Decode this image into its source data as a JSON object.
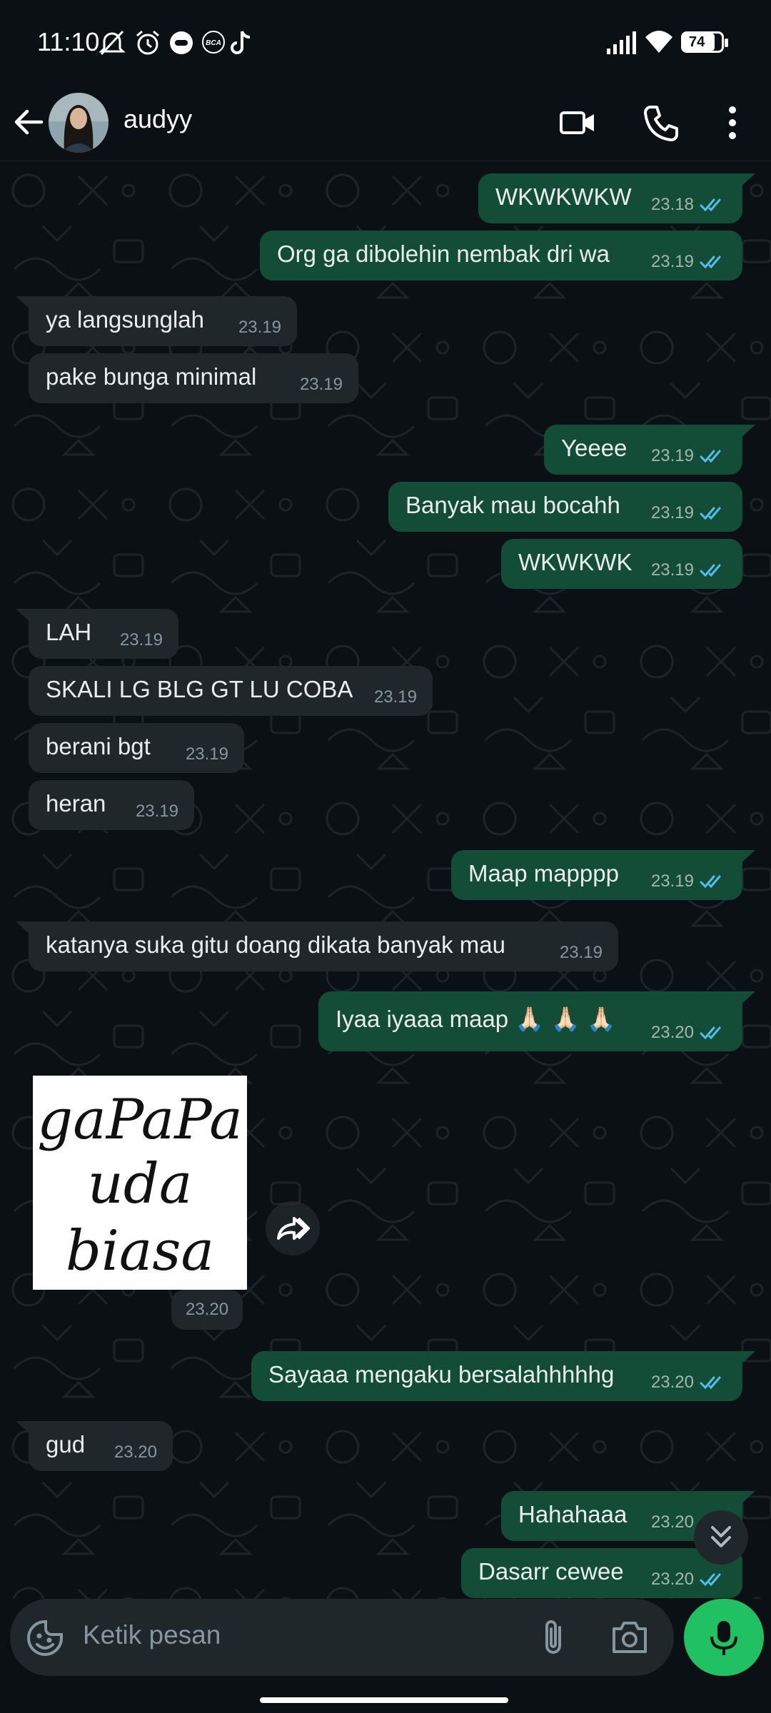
{
  "status_bar": {
    "time": "11:10",
    "battery": "74",
    "left_icons": [
      "mute-icon",
      "alarm-icon",
      "media-icon",
      "bca-icon",
      "tiktok-icon"
    ],
    "right_icons": [
      "signal-icon",
      "wifi-icon",
      "battery-icon"
    ]
  },
  "header": {
    "contact_name": "audyy",
    "icons": [
      "back-arrow-icon",
      "avatar",
      "video-call-icon",
      "voice-call-icon",
      "more-options-icon"
    ]
  },
  "messages": [
    {
      "dir": "out",
      "text": "WKWKWKW",
      "time": "23.18",
      "read": true
    },
    {
      "dir": "out",
      "text": "Org ga dibolehin nembak dri wa",
      "time": "23.19",
      "read": true
    },
    {
      "dir": "in",
      "text": "ya langsunglah",
      "time": "23.19"
    },
    {
      "dir": "in",
      "text": "pake bunga minimal",
      "time": "23.19"
    },
    {
      "dir": "out",
      "text": "Yeeee",
      "time": "23.19",
      "read": true
    },
    {
      "dir": "out",
      "text": "Banyak mau bocahh",
      "time": "23.19",
      "read": true
    },
    {
      "dir": "out",
      "text": "WKWKWK",
      "time": "23.19",
      "read": true
    },
    {
      "dir": "in",
      "text": "LAH",
      "time": "23.19"
    },
    {
      "dir": "in",
      "text": "SKALI LG BLG GT LU COBA",
      "time": "23.19"
    },
    {
      "dir": "in",
      "text": "berani bgt",
      "time": "23.19"
    },
    {
      "dir": "in",
      "text": "heran",
      "time": "23.19"
    },
    {
      "dir": "out",
      "text": "Maap mapppp",
      "time": "23.19",
      "read": true
    },
    {
      "dir": "in",
      "text": "katanya suka gitu doang dikata banyak mau",
      "time": "23.19"
    },
    {
      "dir": "out",
      "text": "Iyaa iyaaa maap 🙏🏻 🙏🏻 🙏🏻",
      "time": "23.20",
      "read": true
    },
    {
      "dir": "out",
      "text": "Sayaaa mengaku bersalahhhhhg",
      "time": "23.20",
      "read": true
    },
    {
      "dir": "in",
      "text": "gud",
      "time": "23.20"
    },
    {
      "dir": "out",
      "text": "Hahahaaa",
      "time": "23.20",
      "read": true
    },
    {
      "dir": "out",
      "text": "Dasarr cewee",
      "time": "23.20",
      "read": true
    }
  ],
  "sticker": {
    "lines": [
      "gaPaPa",
      "uda",
      "biasa"
    ],
    "time": "23.20"
  },
  "composer": {
    "placeholder": "Ketik pesan",
    "icons": [
      "emoji-icon",
      "attach-icon",
      "camera-icon",
      "mic-icon"
    ]
  },
  "colors": {
    "background": "#0b1014",
    "outgoing_bubble": "#144d37",
    "incoming_bubble": "#1f272a",
    "read_tick": "#53bdeb",
    "accent_green": "#21c063"
  }
}
